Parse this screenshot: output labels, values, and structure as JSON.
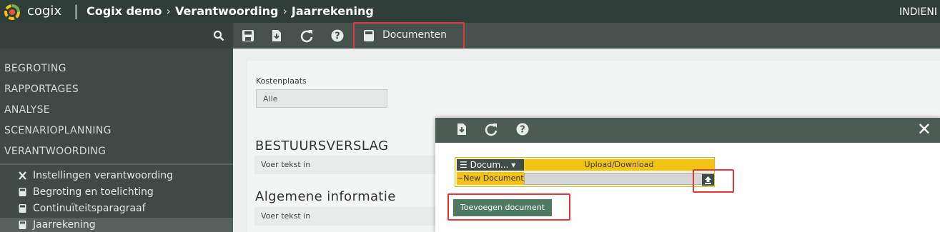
{
  "header": {
    "brand": "cogix",
    "separator": "|",
    "breadcrumb": [
      "Cogix demo",
      "Verantwoording",
      "Jaarrekening"
    ],
    "breadcrumb_separator": "›",
    "right_text": "INDIENI"
  },
  "sidebar": {
    "search_icon": "search-icon",
    "items": [
      {
        "label": "BEGROTING"
      },
      {
        "label": "RAPPORTAGES"
      },
      {
        "label": "ANALYSE"
      },
      {
        "label": "SCENARIOPLANNING"
      },
      {
        "label": "VERANTWOORDING"
      }
    ],
    "subitems": [
      {
        "label": "Instellingen verantwoording",
        "icon": "tools-icon"
      },
      {
        "label": "Begroting en toelichting",
        "icon": "document-icon"
      },
      {
        "label": "Continuïteitsparagraaf",
        "icon": "document-icon"
      },
      {
        "label": "Jaarrekening",
        "icon": "document-icon",
        "active": true
      }
    ]
  },
  "toolbar": {
    "icons": [
      "save-icon",
      "download-icon",
      "refresh-icon",
      "help-icon"
    ],
    "documents_label": "Documenten"
  },
  "main": {
    "cost_center_label": "Kostenplaats",
    "cost_center_value": "Alle",
    "section1_title": "BESTUURSVERSLAG",
    "section1_placeholder": "Voer tekst in",
    "section2_title": "Algemene informatie",
    "section2_placeholder": "Voer tekst in"
  },
  "modal": {
    "icons": [
      "download-icon",
      "refresh-icon",
      "help-icon"
    ],
    "close": "✕",
    "table": {
      "menu_header": "☰ Docum...  ▾",
      "upload_header": "Upload/Download",
      "row_name": "~New Document"
    },
    "add_button": "Toevoegen document"
  },
  "colors": {
    "topbar": "#2f3e38",
    "sidebar": "#3d4a45",
    "toolbar": "#45524d",
    "highlight": "#e8333a",
    "yellow": "#f2c314",
    "green_button": "#4f7a62"
  }
}
